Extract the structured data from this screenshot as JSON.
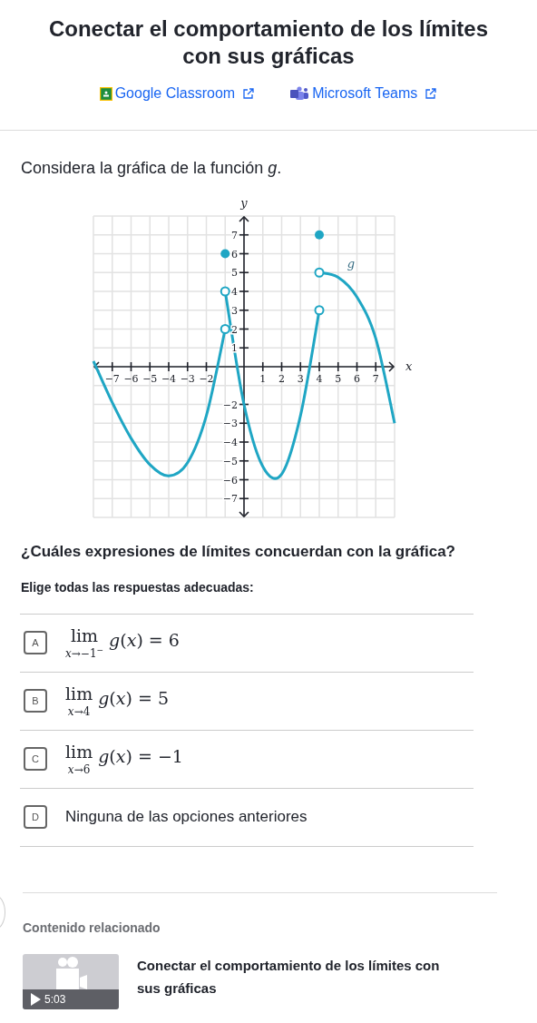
{
  "title": "Conectar el comportamiento de los límites con sus gráficas",
  "share_links": [
    {
      "kind": "classroom",
      "label": "Google Classroom"
    },
    {
      "kind": "teams",
      "label": "Microsoft Teams"
    }
  ],
  "prompt": "Considera la gráfica de la función *g*.",
  "graph": {
    "chart_data": {
      "type": "line",
      "xlabel": "x",
      "ylabel": "y",
      "xlim": [
        -8,
        8
      ],
      "ylim": [
        -8,
        8
      ],
      "x": [
        -8,
        -7,
        -6,
        -5,
        -4,
        -3,
        -2,
        -1,
        0,
        1,
        2,
        3,
        4,
        5,
        6,
        7,
        8
      ],
      "xticks": [
        {
          "value": -7,
          "label": "−7"
        },
        {
          "value": -6,
          "label": "−6"
        },
        {
          "value": -5,
          "label": "−5"
        },
        {
          "value": -4,
          "label": "−4"
        },
        {
          "value": -3,
          "label": "−3"
        },
        {
          "value": -2,
          "label": "−2"
        },
        {
          "value": 1,
          "label": "1"
        },
        {
          "value": 2,
          "label": "2"
        },
        {
          "value": 3,
          "label": "3"
        },
        {
          "value": 4,
          "label": "4"
        },
        {
          "value": 5,
          "label": "5"
        },
        {
          "value": 6,
          "label": "6"
        },
        {
          "value": 7,
          "label": "7"
        }
      ],
      "yticks": [
        {
          "value": 7,
          "label": "7"
        },
        {
          "value": 6,
          "label": "6"
        },
        {
          "value": 5,
          "label": "5"
        },
        {
          "value": 4,
          "label": "4"
        },
        {
          "value": 3,
          "label": "3"
        },
        {
          "value": 2,
          "label": "2"
        },
        {
          "value": 1,
          "label": "1"
        },
        {
          "value": -2,
          "label": "−2"
        },
        {
          "value": -3,
          "label": "−3"
        },
        {
          "value": -4,
          "label": "−4"
        },
        {
          "value": -5,
          "label": "−5"
        },
        {
          "value": -6,
          "label": "−6"
        },
        {
          "value": -7,
          "label": "−7"
        }
      ],
      "series": [
        {
          "color": "#1fa6c4",
          "values": [
            0.3,
            -1.9,
            -3.8,
            -5.2,
            -5.8,
            -5.1,
            -2.6,
            2,
            null,
            null,
            null,
            null,
            null,
            null,
            null,
            null,
            null
          ]
        },
        {
          "color": "#1fa6c4",
          "values": [
            null,
            null,
            null,
            null,
            null,
            null,
            null,
            4,
            -2,
            -5.3,
            -5.7,
            -2.6,
            3,
            null,
            null,
            null,
            null
          ]
        },
        {
          "name": "g",
          "color": "#1fa6c4",
          "values": [
            null,
            null,
            null,
            null,
            null,
            null,
            null,
            null,
            null,
            null,
            null,
            null,
            5,
            4.75,
            3.7,
            1.5,
            -3
          ]
        },
        {
          "type": "scatter",
          "marker": "circle",
          "color": "#1fa6c4",
          "values": [
            null,
            null,
            null,
            null,
            null,
            null,
            null,
            6,
            null,
            null,
            null,
            null,
            7,
            null,
            null,
            null,
            null
          ]
        },
        {
          "type": "scatter",
          "marker": "circle",
          "color": "#1fa6c4",
          "values": [
            null,
            null,
            null,
            null,
            null,
            null,
            null,
            4,
            null,
            null,
            null,
            null,
            5,
            null,
            null,
            null,
            null
          ]
        },
        {
          "type": "scatter",
          "marker": "circle",
          "color": "#1fa6c4",
          "values": [
            null,
            null,
            null,
            null,
            null,
            null,
            null,
            2,
            null,
            null,
            null,
            null,
            3,
            null,
            null,
            null,
            null
          ]
        }
      ],
      "grid": true
    }
  },
  "question": "¿Cuáles expresiones de límites concuerdan con la gráfica?",
  "instruction": "Elige todas las respuestas adecuadas:",
  "choices": [
    {
      "letter": "A",
      "kind": "limit",
      "selected": false,
      "lim": "lim",
      "approach": "*x*→−1$^{−}$",
      "expression": "*g*(*x*) = 6"
    },
    {
      "letter": "B",
      "kind": "limit",
      "selected": false,
      "lim": "lim",
      "approach": "*x*→4",
      "expression": "*g*(*x*) = 5"
    },
    {
      "letter": "C",
      "kind": "limit",
      "selected": false,
      "lim": "lim",
      "approach": "*x*→6",
      "expression": "*g*(*x*) = −1"
    },
    {
      "letter": "D",
      "kind": "text",
      "selected": false,
      "text": "Ninguna de las opciones anteriores"
    }
  ],
  "related": {
    "heading": "Contenido relacionado",
    "items": [
      {
        "kind": "video",
        "duration": "5:03",
        "title": "Conectar el comportamiento de los límites con sus gráficas"
      }
    ]
  }
}
